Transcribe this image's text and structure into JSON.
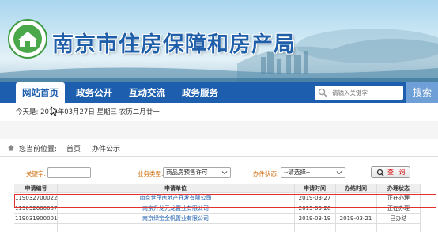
{
  "header": {
    "site_title": "南京市住房保障和房产局",
    "emblem_icon": "emblem-icon",
    "colors": {
      "title": "#1f5faa",
      "nav": "#1d5fae",
      "search_btn": "#6e9fd6",
      "filter_label": "#cc6600",
      "query_text": "#d40000",
      "highlight": "#e03030"
    }
  },
  "nav": {
    "items": [
      "网站首页",
      "政务公开",
      "互动交流",
      "政务服务"
    ],
    "active_index": 0,
    "search_placeholder": "请输入关键字",
    "search_button": "搜索"
  },
  "datebar": {
    "text": "今天是: 2019年03月27日 星期三  农历二月廿一"
  },
  "breadcrumb": {
    "label": "您当前位置:",
    "home": "首页",
    "separator": "|",
    "current": "办件公示"
  },
  "filters": {
    "keyword_label": "关键字:",
    "keyword_value": "",
    "type_label": "业务类型:",
    "type_value": "商品房预售许可",
    "status_label": "办件状态:",
    "status_value": "--请选择--",
    "query_button": "查 询"
  },
  "table": {
    "headers": [
      "申请编号",
      "申请单位",
      "申请时间",
      "办结时间",
      "办理状态"
    ],
    "rows": [
      [
        "119032700022",
        "南京世茂房地产开发有限公司",
        "2019-03-27",
        "",
        "正在办理"
      ],
      [
        "119032600007",
        "南京升龙元龙置业有限公司",
        "2019-03-26",
        "",
        "正在办理"
      ],
      [
        "119031900001",
        "南京绿宝金帆置业有限公司",
        "2019-03-19",
        "2019-03-21",
        "已办结"
      ]
    ],
    "highlighted_row": 0
  }
}
